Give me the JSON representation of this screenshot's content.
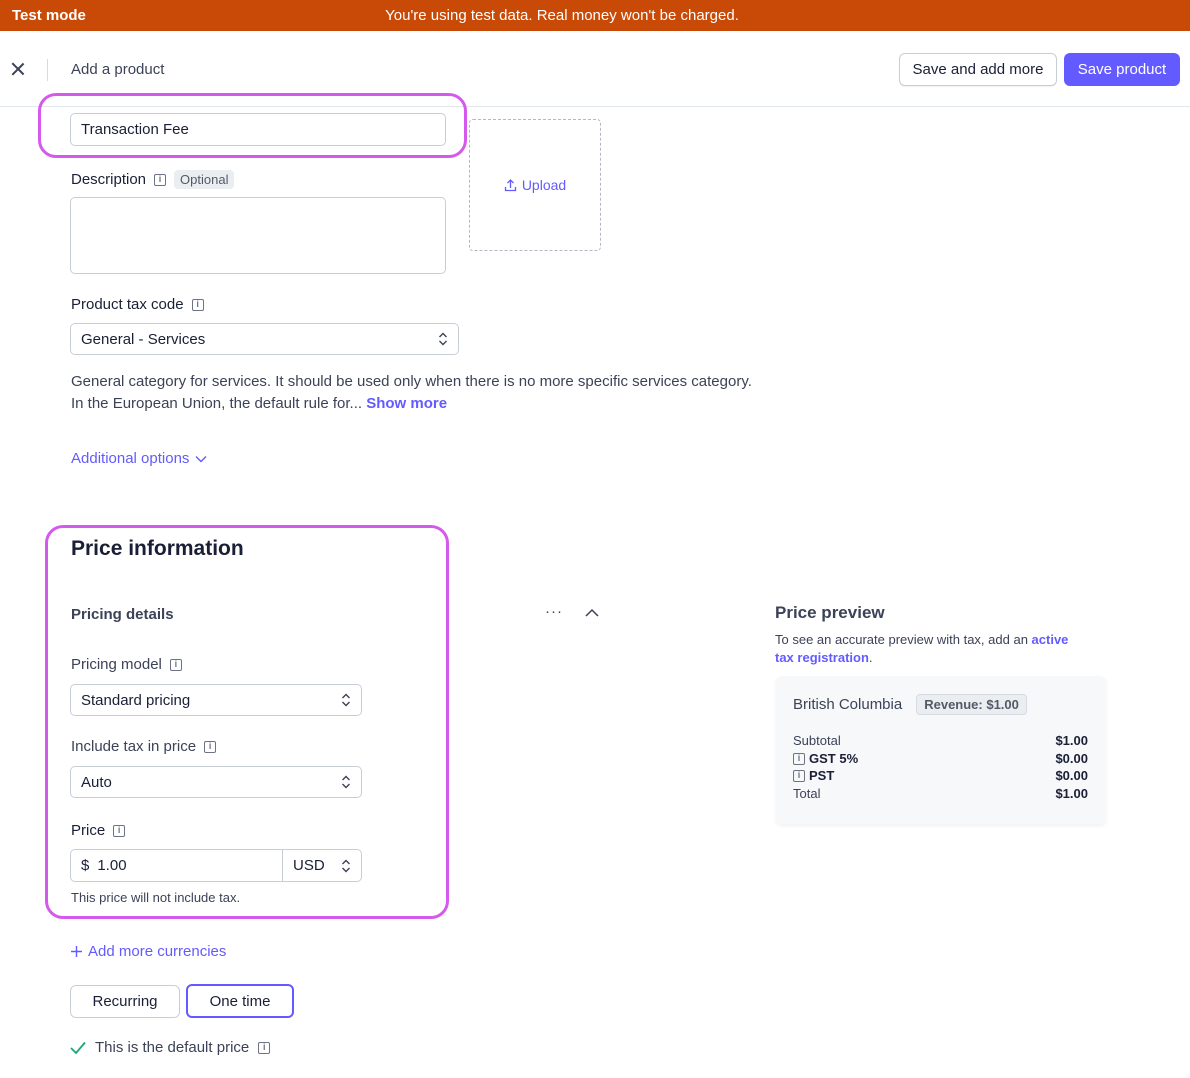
{
  "banner": {
    "mode": "Test mode",
    "message": "You're using test data. Real money won't be charged."
  },
  "header": {
    "title": "Add a product",
    "save_more": "Save and add more",
    "save": "Save product"
  },
  "form": {
    "name_value": "Transaction Fee",
    "description_label": "Description",
    "optional_badge": "Optional",
    "upload": "Upload",
    "tax_code_label": "Product tax code",
    "tax_code_value": "General - Services",
    "tax_help_line1": "General category for services. It should be used only when there is no more specific services category.",
    "tax_help_line2": "In the European Union, the default rule for...",
    "show_more": "Show more",
    "additional_options": "Additional options"
  },
  "price": {
    "section_title": "Price information",
    "details_title": "Pricing details",
    "model_label": "Pricing model",
    "model_value": "Standard pricing",
    "tax_incl_label": "Include tax in price",
    "tax_incl_value": "Auto",
    "price_label": "Price",
    "currency_symbol": "$",
    "amount": "1.00",
    "currency": "USD",
    "tax_note": "This price will not include tax.",
    "add_currencies": "Add more currencies",
    "recurring": "Recurring",
    "one_time": "One time",
    "default_note": "This is the default price"
  },
  "preview": {
    "title": "Price preview",
    "desc_prefix": "To see an accurate preview with tax, add an ",
    "desc_link_1": "active",
    "desc_link_2": "tax registration",
    "region": "British Columbia",
    "revenue_badge": "Revenue: $1.00",
    "rows": [
      {
        "label": "Subtotal",
        "value": "$1.00"
      },
      {
        "label": "GST 5%",
        "value": "$0.00"
      },
      {
        "label": "PST",
        "value": "$0.00"
      },
      {
        "label": "Total",
        "value": "$1.00"
      }
    ]
  },
  "colors": {
    "banner": "#c94a06",
    "accent": "#635bff",
    "highlight": "#d559ec",
    "check": "#1ea672"
  }
}
